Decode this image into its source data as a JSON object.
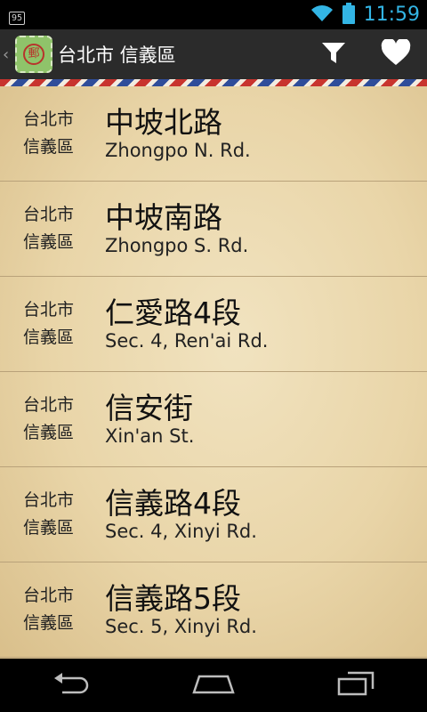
{
  "status_bar": {
    "notification_badge": "95",
    "time": "11:59",
    "accent_color": "#33b5e5"
  },
  "action_bar": {
    "app_icon_glyph": "郵",
    "title": "台北市 信義區",
    "filter_icon": "filter-icon",
    "favorite_icon": "heart-icon"
  },
  "list": {
    "items": [
      {
        "city": "台北市",
        "district": "信義區",
        "road_zh": "中坡北路",
        "road_en": "Zhongpo N. Rd."
      },
      {
        "city": "台北市",
        "district": "信義區",
        "road_zh": "中坡南路",
        "road_en": "Zhongpo S. Rd."
      },
      {
        "city": "台北市",
        "district": "信義區",
        "road_zh": "仁愛路4段",
        "road_en": "Sec. 4, Ren'ai Rd."
      },
      {
        "city": "台北市",
        "district": "信義區",
        "road_zh": "信安街",
        "road_en": "Xin'an St."
      },
      {
        "city": "台北市",
        "district": "信義區",
        "road_zh": "信義路4段",
        "road_en": "Sec. 4, Xinyi Rd."
      },
      {
        "city": "台北市",
        "district": "信義區",
        "road_zh": "信義路5段",
        "road_en": "Sec. 5, Xinyi Rd."
      }
    ]
  },
  "nav_bar": {
    "back_icon": "back-icon",
    "home_icon": "home-icon",
    "recents_icon": "recents-icon"
  }
}
